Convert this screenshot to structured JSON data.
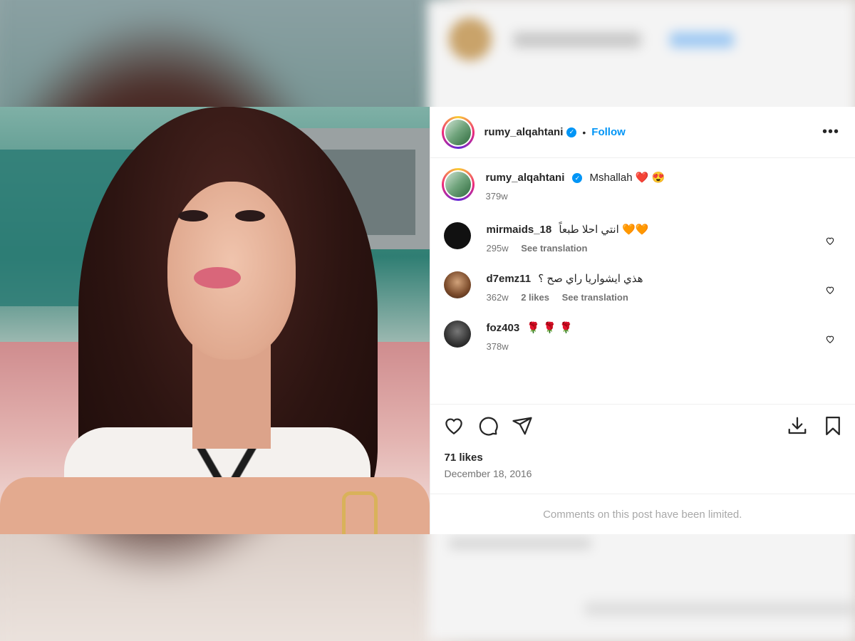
{
  "post": {
    "username": "rumy_alqahtani",
    "follow_label": "Follow",
    "dot": "•",
    "more": "•••",
    "caption": {
      "text": "Mshallah",
      "emoji": "❤️ 😍",
      "age": "379w"
    },
    "likes": "71 likes",
    "date": "December 18, 2016",
    "limited_note": "Comments on this post have been limited."
  },
  "comments": [
    {
      "username": "mirmaids_18",
      "text": "انتي احلا طبعاً 🧡🧡",
      "age": "295w",
      "likes": "",
      "translate": "See translation"
    },
    {
      "username": "d7emz11",
      "text": "هذي ايشواريا راي صح ؟",
      "age": "362w",
      "likes": "2 likes",
      "translate": "See translation"
    },
    {
      "username": "foz403",
      "text": "🌹 🌹 🌹",
      "age": "378w",
      "likes": "",
      "translate": ""
    }
  ],
  "icons": {
    "like": "heart-icon",
    "comment": "comment-icon",
    "share": "share-icon",
    "download": "download-icon",
    "save": "bookmark-icon",
    "verified": "verified-badge-icon"
  },
  "colors": {
    "accent": "#0095f6",
    "text": "#262626",
    "muted": "#737373"
  }
}
